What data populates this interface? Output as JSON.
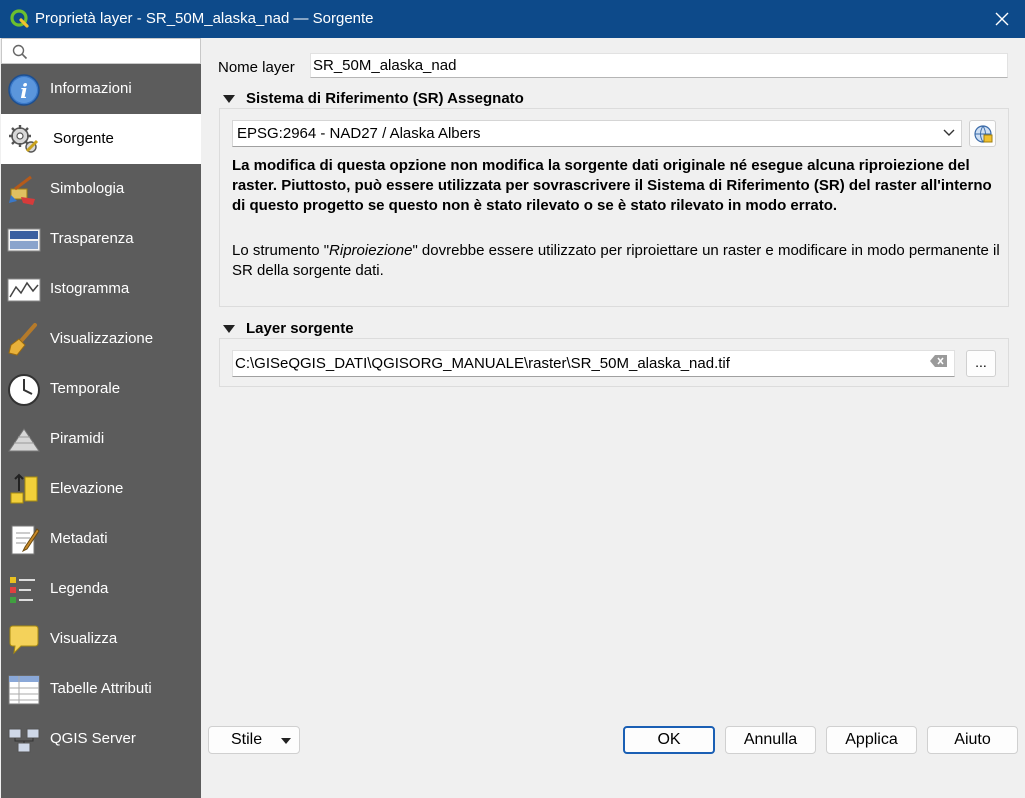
{
  "window": {
    "title": "Proprietà layer - SR_50M_alaska_nad — Sorgente"
  },
  "sidebar": {
    "search_placeholder": "",
    "items": [
      {
        "label": "Informazioni",
        "icon": "info-icon"
      },
      {
        "label": "Sorgente",
        "icon": "gears-icon",
        "active": true
      },
      {
        "label": "Simbologia",
        "icon": "paintbrush-icon"
      },
      {
        "label": "Trasparenza",
        "icon": "transparency-icon"
      },
      {
        "label": "Istogramma",
        "icon": "histogram-icon"
      },
      {
        "label": "Visualizzazione",
        "icon": "brush-icon"
      },
      {
        "label": "Temporale",
        "icon": "clock-icon"
      },
      {
        "label": "Piramidi",
        "icon": "pyramid-icon"
      },
      {
        "label": "Elevazione",
        "icon": "elevation-icon"
      },
      {
        "label": "Metadati",
        "icon": "metadata-icon"
      },
      {
        "label": "Legenda",
        "icon": "legend-icon"
      },
      {
        "label": "Visualizza",
        "icon": "speech-bubble-icon"
      },
      {
        "label": "Tabelle Attributi",
        "icon": "attribute-table-icon"
      },
      {
        "label": "QGIS Server",
        "icon": "server-icon"
      }
    ]
  },
  "main": {
    "name_label": "Nome layer",
    "name_value": "SR_50M_alaska_nad",
    "crs_group": {
      "title": "Sistema di Riferimento (SR) Assegnato",
      "selected": "EPSG:2964 - NAD27 / Alaska Albers",
      "warning": "La modifica di questa opzione non modifica la sorgente dati originale né esegue alcuna riproiezione del raster. Piuttosto, può essere utilizzata per sovrascrivere il Sistema di Riferimento (SR) del raster all'interno di questo progetto se questo non è stato rilevato o se è stato rilevato in modo errato.",
      "note_prefix": "Lo strumento \"",
      "note_tool": "Riproiezione",
      "note_suffix": "\" dovrebbe essere utilizzato per riproiettare un raster e modificare in modo permanente il SR della sorgente dati."
    },
    "source_group": {
      "title": "Layer sorgente",
      "path": "C:\\GISeQGIS_DATI\\QGISORG_MANUALE\\raster\\SR_50M_alaska_nad.tif",
      "browse_label": "..."
    }
  },
  "footer": {
    "style_label": "Stile",
    "ok_label": "OK",
    "cancel_label": "Annulla",
    "apply_label": "Applica",
    "help_label": "Aiuto"
  },
  "colors": {
    "titlebar": "#0d4a8a",
    "sidebar": "#5c5c5c",
    "accent": "#1a5fb4"
  }
}
